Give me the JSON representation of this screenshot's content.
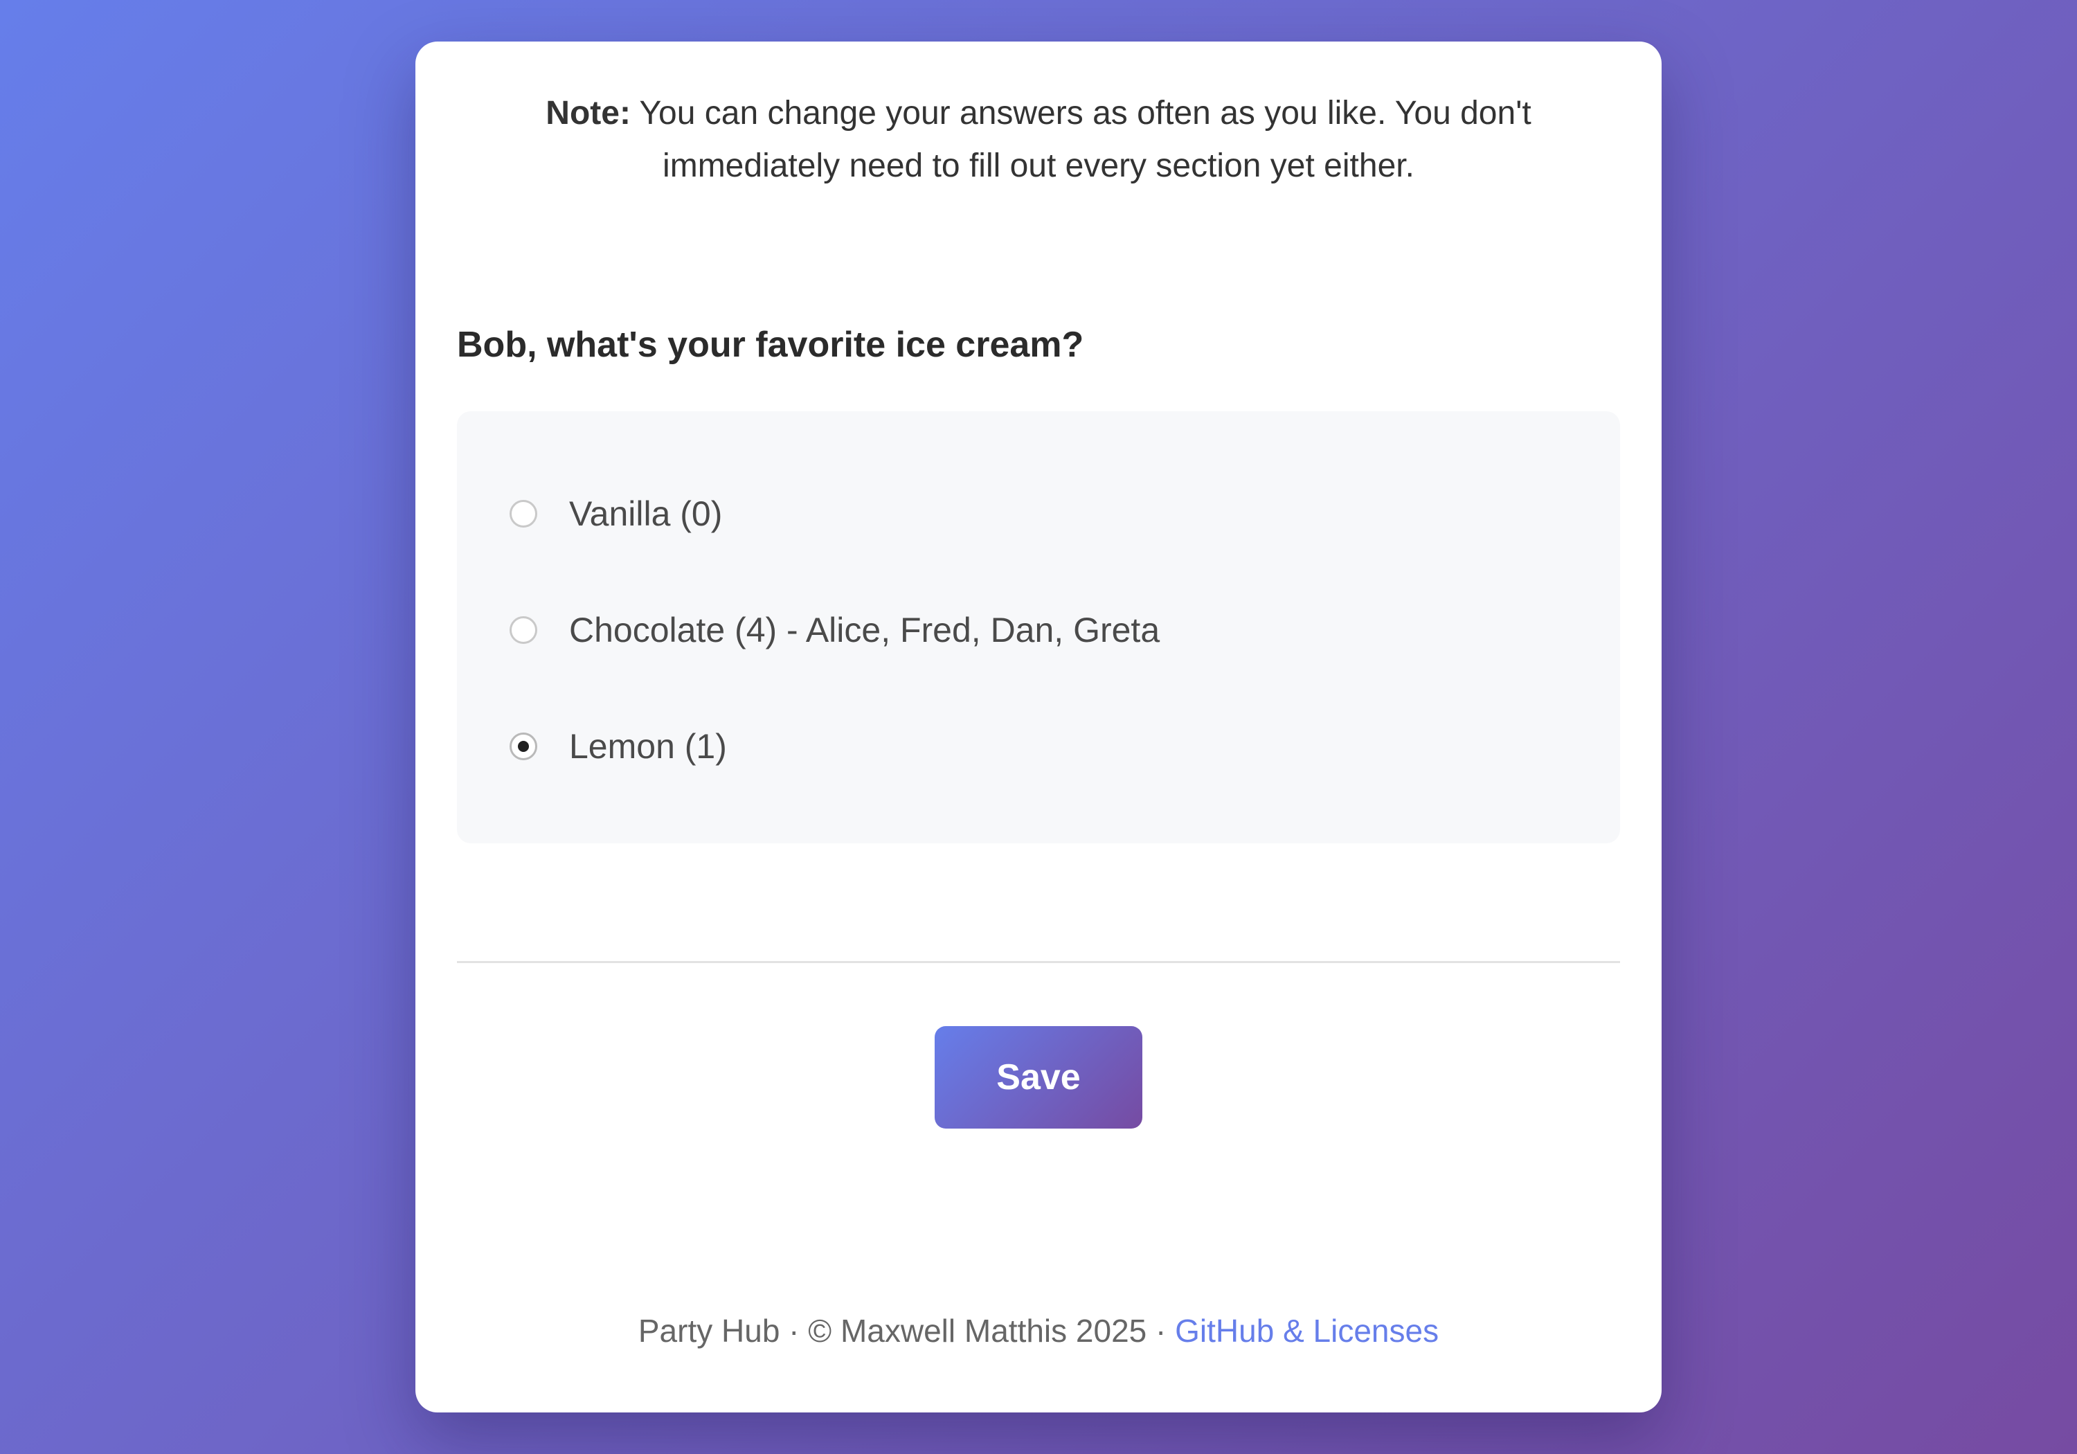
{
  "note": {
    "label": "Note:",
    "text": " You can change your answers as often as you like. You don't immediately need to fill out every section yet either."
  },
  "question": {
    "text": "Bob, what's your favorite ice cream?",
    "options": [
      {
        "label": "Vanilla (0)",
        "selected": false
      },
      {
        "label": "Chocolate (4) - Alice, Fred, Dan, Greta",
        "selected": false
      },
      {
        "label": "Lemon (1)",
        "selected": true
      }
    ]
  },
  "actions": {
    "save_label": "Save"
  },
  "footer": {
    "text": "Party Hub · © Maxwell Matthis 2025 · ",
    "link_label": "GitHub & Licenses"
  },
  "colors": {
    "gradient_start": "#667eea",
    "gradient_end": "#764ba2",
    "link": "#667eea"
  }
}
